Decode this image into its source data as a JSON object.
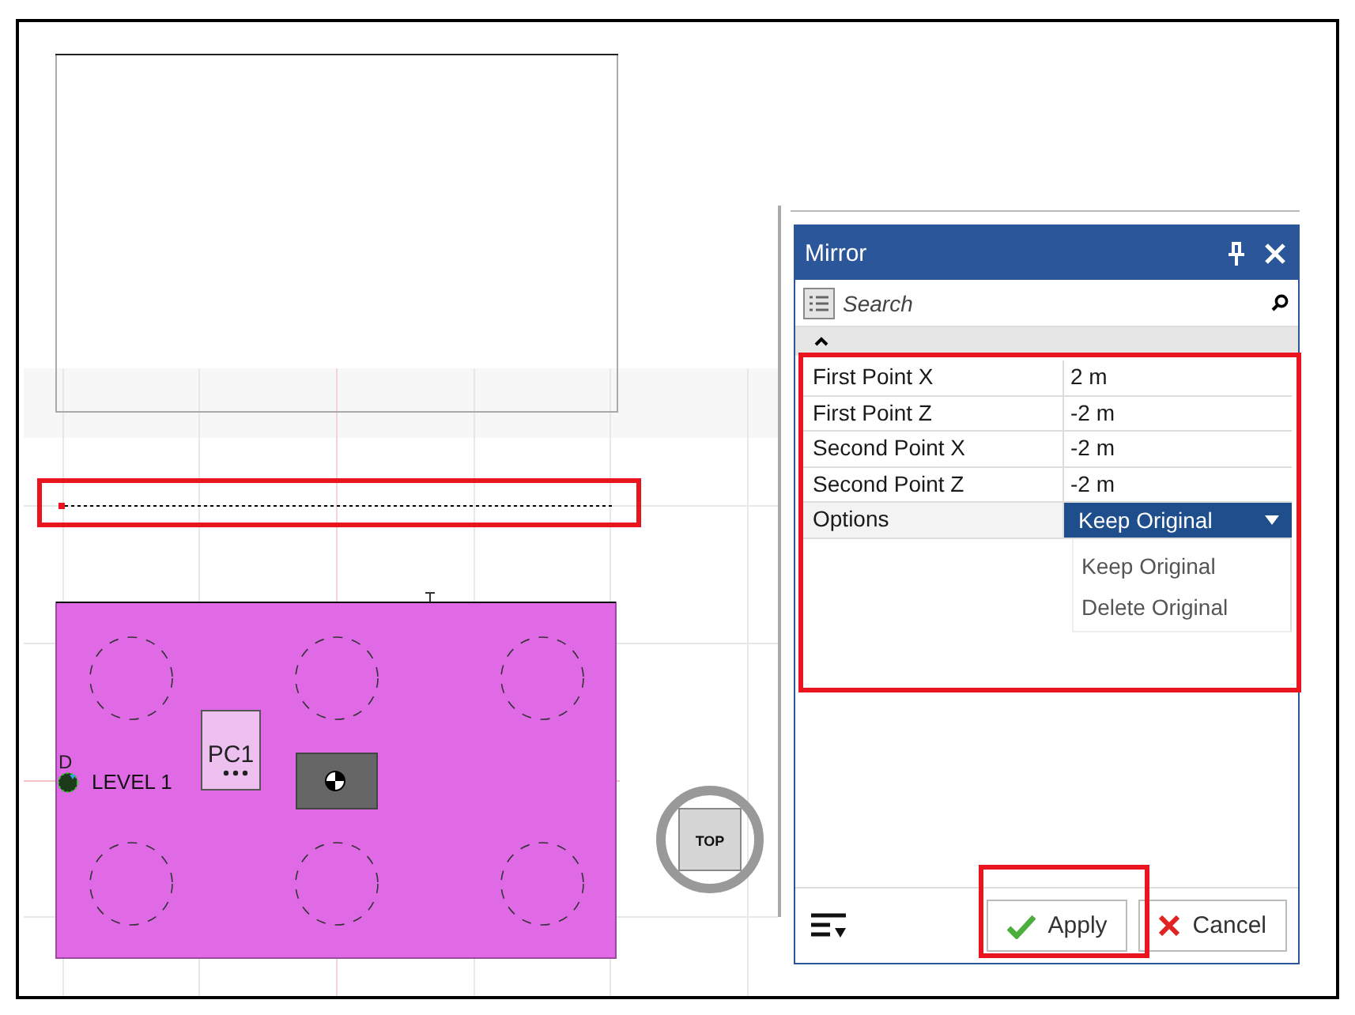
{
  "canvas": {
    "marker_letter": "D",
    "level_label": "LEVEL 1",
    "column_label": "PC1",
    "view_cube_label": "TOP"
  },
  "panel": {
    "title": "Mirror",
    "search": {
      "placeholder": "Search"
    },
    "properties": [
      {
        "name": "First Point X",
        "value": "2 m",
        "kind": "text"
      },
      {
        "name": "First Point Z",
        "value": "-2 m",
        "kind": "text"
      },
      {
        "name": "Second Point X",
        "value": "-2 m",
        "kind": "text"
      },
      {
        "name": "Second Point Z",
        "value": "-2 m",
        "kind": "text"
      },
      {
        "name": "Options",
        "value": "Keep Original",
        "kind": "dropdown"
      }
    ],
    "dropdown_options": [
      "Keep Original",
      "Delete Original"
    ],
    "buttons": [
      {
        "label": "Apply",
        "kind": "apply"
      },
      {
        "label": "Cancel",
        "kind": "cancel"
      }
    ]
  }
}
